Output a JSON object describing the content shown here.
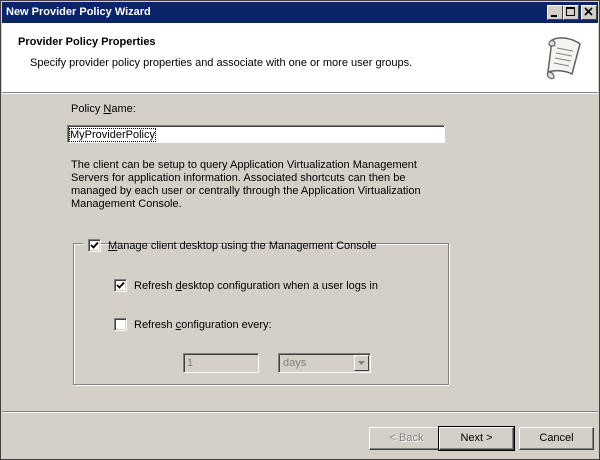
{
  "window": {
    "title": "New Provider Policy Wizard"
  },
  "header": {
    "title": "Provider Policy Properties",
    "subtitle": "Specify provider policy properties and associate with one or more user groups."
  },
  "policy_name": {
    "label_before": "Policy ",
    "label_accel": "N",
    "label_after": "ame:",
    "value": "MyProviderPolicy"
  },
  "description": "The client can be setup to query Application Virtualization Management Servers for application information.  Associated shortcuts can then be managed by each user or centrally through the Application Virtualization Management Console.",
  "manage_group": {
    "checked": true,
    "label_accel": "M",
    "label_rest": "anage client desktop using the Management Console"
  },
  "refresh_login": {
    "checked": true,
    "label_before": "Refresh ",
    "label_accel": "d",
    "label_after": "esktop configuration when a user logs in"
  },
  "refresh_every": {
    "checked": false,
    "label_before": "Refresh ",
    "label_accel": "c",
    "label_after": "onfiguration every:",
    "interval_value": "1",
    "unit_value": "days"
  },
  "buttons": {
    "back_label": "< Back",
    "back_accel": "B",
    "next_label": "Next >",
    "next_accel": "N",
    "cancel_label": "Cancel"
  }
}
